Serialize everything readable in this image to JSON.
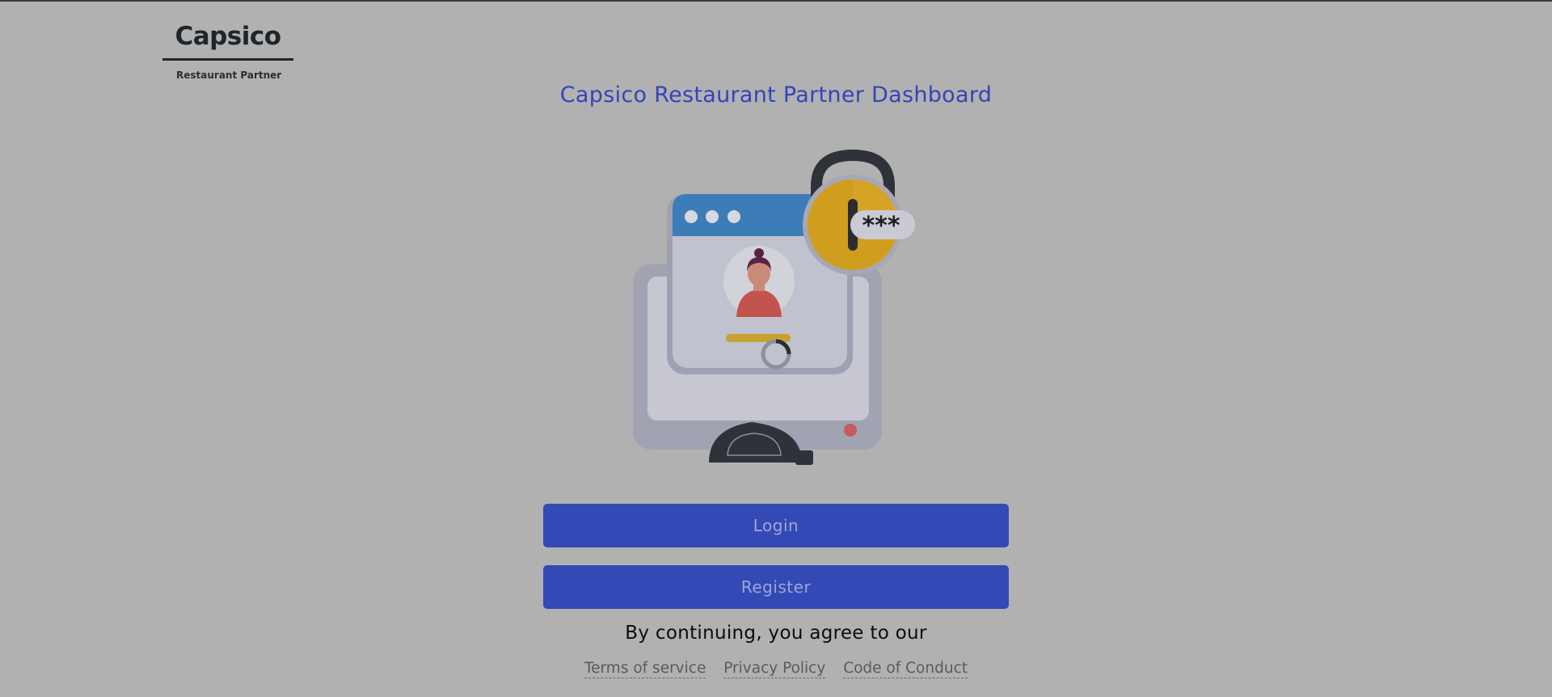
{
  "brand": {
    "name": "Capsico",
    "subtitle": "Restaurant Partner"
  },
  "page": {
    "title": "Capsico Restaurant Partner Dashboard"
  },
  "illustration": {
    "password_mask": "***"
  },
  "actions": {
    "login_label": "Login",
    "register_label": "Register"
  },
  "legal": {
    "agree_text": "By continuing, you agree to our",
    "links": [
      {
        "label": "Terms of service"
      },
      {
        "label": "Privacy Policy"
      },
      {
        "label": "Code of Conduct"
      }
    ]
  },
  "colors": {
    "background": "#b1b1b1",
    "accent": "#3349b6",
    "title": "#3345b8"
  }
}
